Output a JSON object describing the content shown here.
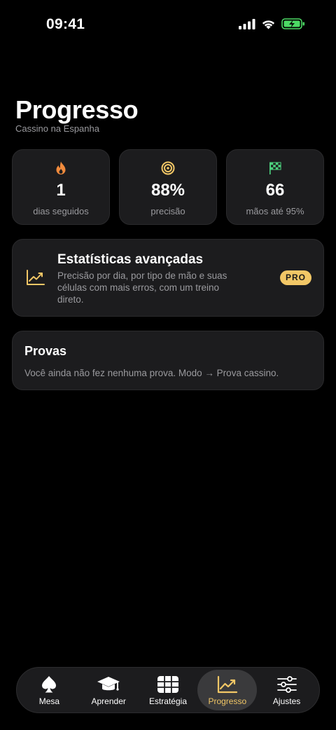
{
  "status_bar": {
    "time": "09:41"
  },
  "header": {
    "title": "Progresso",
    "subtitle": "Cassino na Espanha"
  },
  "stats": [
    {
      "icon": "flame-icon",
      "value": "1",
      "label": "dias seguidos",
      "color": "#f08a3c"
    },
    {
      "icon": "target-icon",
      "value": "88%",
      "label": "precisão",
      "color": "#f2c766"
    },
    {
      "icon": "checkered-flag-icon",
      "value": "66",
      "label": "mãos até 95%",
      "color": "#4cd07d"
    }
  ],
  "advanced": {
    "title": "Estatísticas avançadas",
    "description": "Precisão por dia, por tipo de mão e suas células com mais erros, com um treino direto.",
    "badge": "PRO",
    "icon": "chart-trend-icon"
  },
  "provas": {
    "title": "Provas",
    "text": "Você ainda não fez nenhuma prova. Modo → Prova cassino."
  },
  "tabs": [
    {
      "label": "Mesa",
      "icon": "spade-icon",
      "active": false
    },
    {
      "label": "Aprender",
      "icon": "graduation-cap-icon",
      "active": false
    },
    {
      "label": "Estratégia",
      "icon": "grid-table-icon",
      "active": false
    },
    {
      "label": "Progresso",
      "icon": "chart-trend-icon",
      "active": true
    },
    {
      "label": "Ajustes",
      "icon": "sliders-icon",
      "active": false
    }
  ],
  "colors": {
    "accent": "#f2c766",
    "card": "#1c1c1e",
    "background": "#000000",
    "muted_text": "#9a9a9e"
  }
}
